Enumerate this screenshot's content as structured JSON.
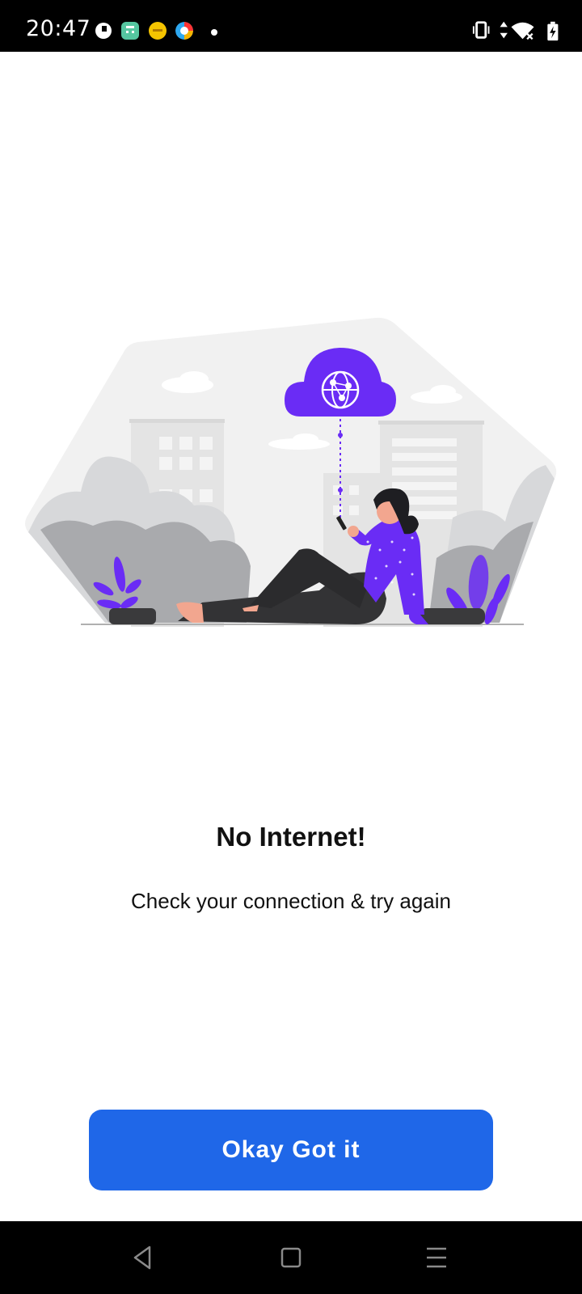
{
  "status_bar": {
    "time": "20:47",
    "app_icons": [
      "app-icon-c",
      "app-icon-calculator",
      "app-icon-emoji",
      "app-icon-color"
    ],
    "right_icons": [
      "vibrate-icon",
      "data-arrows-icon",
      "wifi-off-icon",
      "battery-charging-icon"
    ]
  },
  "illustration": {
    "name": "no-internet-illustration",
    "accent_color": "#6a2cf5"
  },
  "title": "No Internet!",
  "subtitle": "Check your connection & try again",
  "button": {
    "label": "Okay Got it",
    "color": "#1f67e8"
  },
  "nav_bar": {
    "buttons": [
      "back-icon",
      "home-icon",
      "recents-icon"
    ]
  }
}
